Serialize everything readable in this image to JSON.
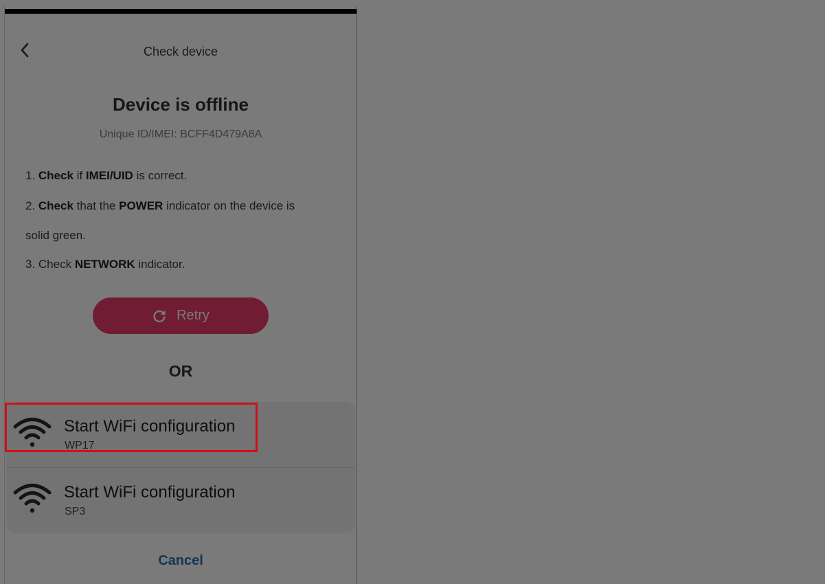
{
  "appbar": {
    "title": "Check device",
    "back_icon": "chevron-left-icon"
  },
  "status": {
    "headline": "Device is offline",
    "uid_line": "Unique ID/IMEI: BCFF4D479A8A"
  },
  "instructions": {
    "line1_num": "1. ",
    "line1_b1": "Check",
    "line1_t1": " if ",
    "line1_b2": "IMEI/UID",
    "line1_t2": " is correct.",
    "line2_num": "2. ",
    "line2_b1": "Check",
    "line2_t1": " that the ",
    "line2_b2": "POWER",
    "line2_t2": " indicator on the device is",
    "line2_cont": "solid green.",
    "line3_t1": "3. Check ",
    "line3_b1": "NETWORK",
    "line3_t2": " indicator."
  },
  "retry": {
    "label": "Retry",
    "icon": "refresh-icon"
  },
  "or_label": "OR",
  "wifi_options": [
    {
      "title": "Start WiFi configuration",
      "subtitle": "WP17",
      "icon": "wifi-icon"
    },
    {
      "title": "Start WiFi configuration",
      "subtitle": "SP3",
      "icon": "wifi-icon"
    }
  ],
  "cancel_label": "Cancel",
  "colors": {
    "retry_bg": "#ea3c6c",
    "cancel_text": "#2b6fb5",
    "highlight_border": "#d01018"
  }
}
